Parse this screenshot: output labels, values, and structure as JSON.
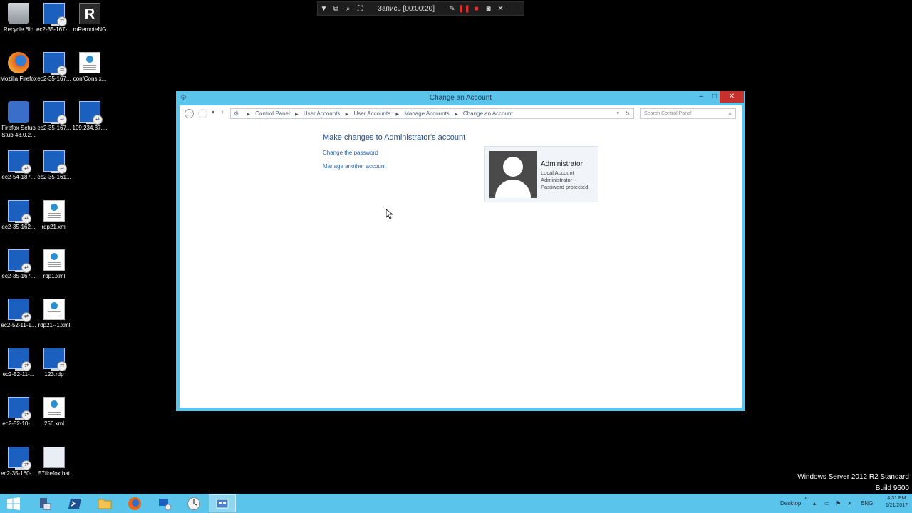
{
  "recorder": {
    "title": "Запись [00:00:20]",
    "icons": [
      "dropdown-icon",
      "window-icon",
      "zoom-icon",
      "region-icon",
      "pen-icon",
      "pause-icon",
      "stop-icon",
      "camera-icon",
      "close-icon"
    ]
  },
  "desktop_icons": [
    {
      "label": "Recycle Bin",
      "icon": "recycle-bin-icon"
    },
    {
      "label": "ec2-35-167-...",
      "icon": "rdp-icon"
    },
    {
      "label": "mRemoteNG",
      "icon": "mremoteng-icon"
    },
    {
      "label": "Mozilla Firefox",
      "icon": "firefox-icon"
    },
    {
      "label": "ec2-35-167...",
      "icon": "rdp-icon"
    },
    {
      "label": "confCons.x...",
      "icon": "document-icon"
    },
    {
      "label": "Firefox Setup Stub 48.0.2...",
      "icon": "firefox-setup-icon"
    },
    {
      "label": "ec2-35-167...",
      "icon": "rdp-icon"
    },
    {
      "label": "109.234.37....",
      "icon": "rdp-icon"
    },
    {
      "label": "ec2-54-187...",
      "icon": "rdp-icon"
    },
    {
      "label": "ec2-35-161...",
      "icon": "rdp-icon"
    },
    {
      "label": "ec2-35-162...",
      "icon": "rdp-icon"
    },
    {
      "label": "rdp21.xml",
      "icon": "document-icon"
    },
    {
      "label": "ec2-35-167...",
      "icon": "rdp-icon"
    },
    {
      "label": "rdp1.xml",
      "icon": "document-icon"
    },
    {
      "label": "ec2-52-11-1...",
      "icon": "rdp-icon"
    },
    {
      "label": "rdp21--1.xml",
      "icon": "document-icon"
    },
    {
      "label": "ec2-52-11-...",
      "icon": "rdp-icon"
    },
    {
      "label": "123.rdp",
      "icon": "rdp-icon"
    },
    {
      "label": "ec2-52-10-...",
      "icon": "rdp-icon"
    },
    {
      "label": "256.xml",
      "icon": "document-icon"
    },
    {
      "label": "ec2-35-160-...",
      "icon": "rdp-icon"
    },
    {
      "label": "57firefox.bat",
      "icon": "batch-file-icon"
    }
  ],
  "window": {
    "title": "Change an Account",
    "breadcrumb": [
      "Control Panel",
      "User Accounts",
      "User Accounts",
      "Manage Accounts",
      "Change an Account"
    ],
    "search_placeholder": "Search Control Panel",
    "heading": "Make changes to Administrator's account",
    "links": [
      "Change the password",
      "Manage another account"
    ],
    "account": {
      "name": "Administrator",
      "details": [
        "Local Account",
        "Administrator",
        "Password protected"
      ]
    }
  },
  "watermark": {
    "line1": "Windows Server 2012 R2 Standard",
    "line2": "Build 9600"
  },
  "taskbar": {
    "apps": [
      "windows-start-icon",
      "server-manager-icon",
      "powershell-icon",
      "file-explorer-icon",
      "firefox-icon",
      "remote-desktop-icon",
      "clock-app-icon",
      "control-panel-icon"
    ],
    "desktop_label": "Desktop",
    "chevron": "»",
    "language": "ENG",
    "time": "4:31 PM",
    "date": "1/21/2017"
  }
}
